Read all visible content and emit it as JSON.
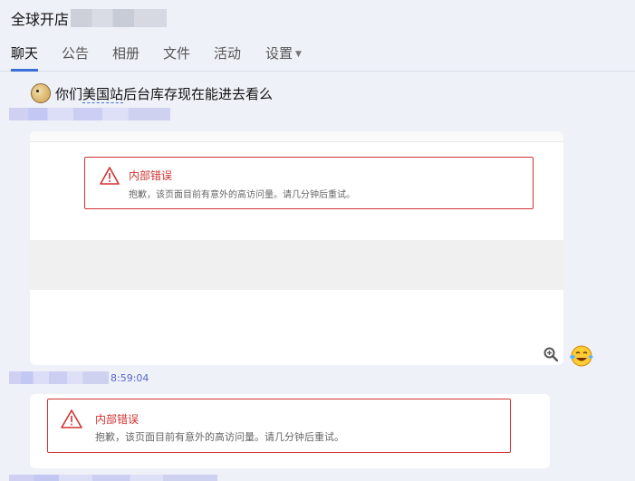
{
  "header": {
    "title": "全球开店"
  },
  "tabs": [
    {
      "label": "聊天",
      "active": true
    },
    {
      "label": "公告"
    },
    {
      "label": "相册"
    },
    {
      "label": "文件"
    },
    {
      "label": "活动"
    },
    {
      "label": "设置",
      "has_dropdown": true
    }
  ],
  "messages": {
    "first": {
      "prefix": "你们",
      "link": "美国站",
      "suffix": "后台库存现在能进去看么"
    },
    "second": {
      "time": "8:59:04"
    }
  },
  "error_card_1": {
    "title": "内部错误",
    "description": "抱歉，该页面目前有意外的高访问量。请几分钟后重试。"
  },
  "error_card_2": {
    "title": "内部错误",
    "description": "抱歉，该页面目前有意外的高访问量。请几分钟后重试。"
  },
  "colors": {
    "accent": "#3b6fd6",
    "error": "#d23232",
    "background": "#eef1f8"
  },
  "icons": {
    "zoom": "zoom-in-icon",
    "emoji": "laughing-emoji-icon",
    "warning": "warning-triangle-icon",
    "avatar": "bird-avatar-icon"
  }
}
